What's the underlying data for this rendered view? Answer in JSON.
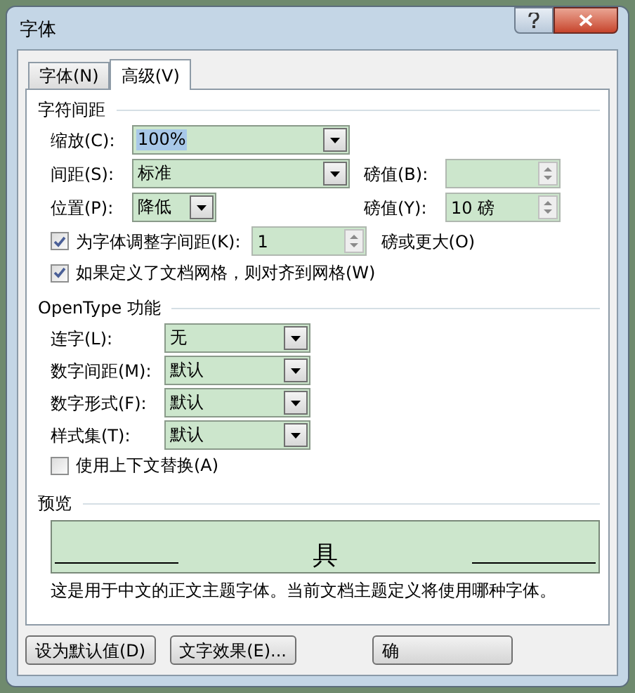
{
  "window": {
    "title": "字体"
  },
  "tabs": [
    {
      "label": "字体(N)",
      "selected": false
    },
    {
      "label": "高级(V)",
      "selected": true
    }
  ],
  "character_spacing": {
    "title": "字符间距",
    "scale": {
      "label": "缩放(C):",
      "value": "100%"
    },
    "spacing": {
      "label": "间距(S):",
      "value": "标准",
      "points_label": "磅值(B):"
    },
    "position": {
      "label": "位置(P):",
      "value": "降低",
      "points_label": "磅值(Y):",
      "points_value": "10 磅"
    },
    "kerning": {
      "label": "为字体调整字间距(K):",
      "checked": true,
      "value": "1",
      "suffix": "磅或更大(O)"
    },
    "snap_to_grid": {
      "label": "如果定义了文档网格，则对齐到网格(W)",
      "checked": true
    }
  },
  "opentype": {
    "title": "OpenType 功能",
    "dropdowns": [
      {
        "label": "连字(L):",
        "value": "无"
      },
      {
        "label": "数字间距(M):",
        "value": "默认"
      },
      {
        "label": "数字形式(F):",
        "value": "默认"
      },
      {
        "label": "样式集(T):",
        "value": "默认"
      }
    ],
    "contextual_alternates": {
      "label": "使用上下文替换(A)",
      "checked": false
    }
  },
  "preview": {
    "title": "预览",
    "sample": "具",
    "description": "这是用于中文的正文主题字体。当前文档主题定义将使用哪种字体。"
  },
  "buttons": [
    "设为默认值(D)",
    "文字效果(E)...",
    "确"
  ]
}
